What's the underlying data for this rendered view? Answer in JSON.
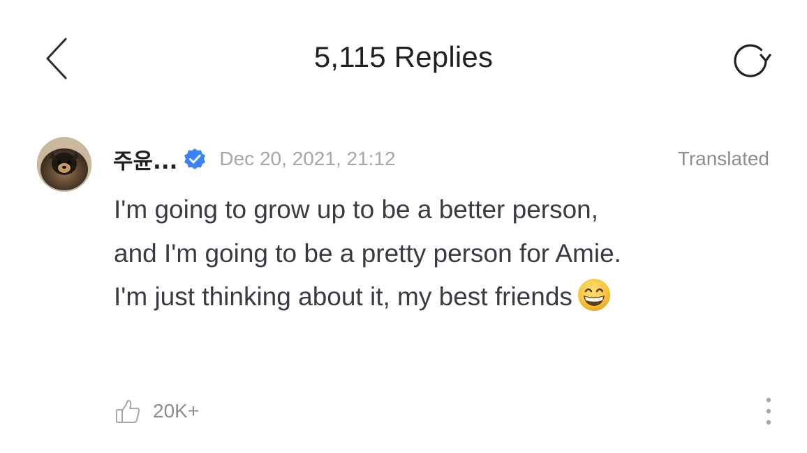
{
  "header": {
    "title": "5,115 Replies",
    "back_icon": "chevron-left-icon",
    "refresh_icon": "refresh-icon"
  },
  "reply": {
    "username": "주윤...",
    "verified": true,
    "date": "Dec 20, 2021, 21:12",
    "translated_label": "Translated",
    "text": "I'm going to grow up to be a better person, and I'm going to be a pretty person for Amie. I'm just thinking about it, my best friends",
    "emoji": "grinning-face-with-smiling-eyes",
    "like_count": "20K+",
    "like_icon": "thumbs-up-icon",
    "more_icon": "more-vertical-icon"
  },
  "colors": {
    "verified_blue": "#3b82f6",
    "muted_gray": "#a5a5ab",
    "text_dark": "#1f1f24"
  }
}
